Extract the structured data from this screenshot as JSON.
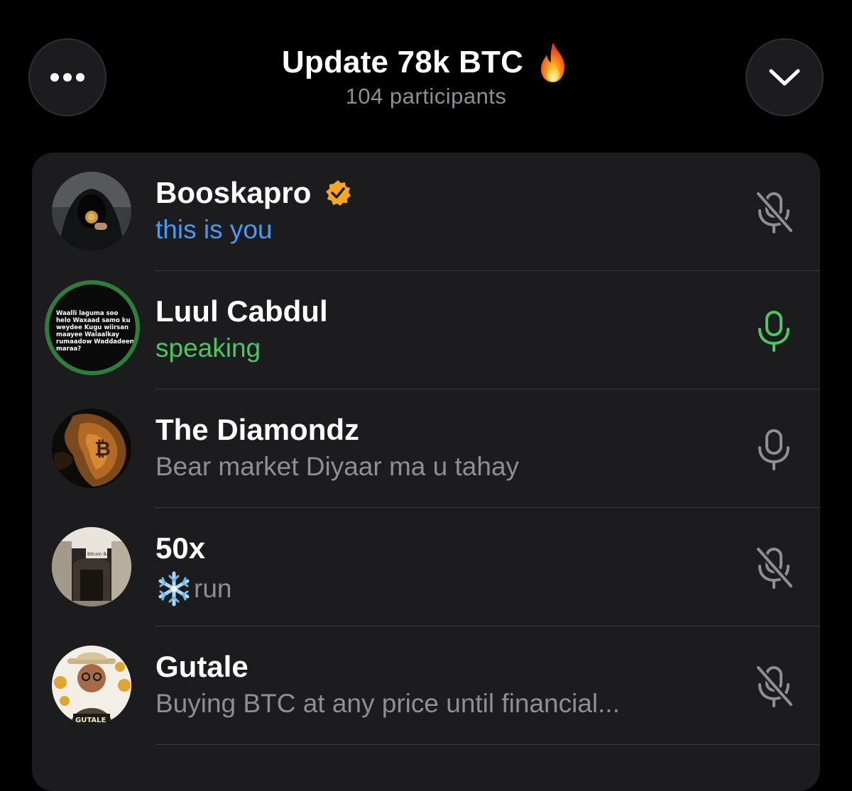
{
  "header": {
    "title": "Update 78k BTC",
    "title_icon": "fire-icon",
    "subtitle": "104 participants",
    "more_icon": "more-horizontal-icon",
    "collapse_icon": "chevron-down-icon"
  },
  "colors": {
    "background": "#000000",
    "panel": "#1c1c1e",
    "blue_status": "#4a9af5",
    "green_status": "#4cc662",
    "muted": "#8e8e93",
    "verified": "#f5a623"
  },
  "participants": [
    {
      "name": "Booskapro",
      "verified": true,
      "status": "this is you",
      "status_color": "blue",
      "mic": "muted",
      "avatar": "hooded-figure-with-bitcoin-avatar"
    },
    {
      "name": "Luul Cabdul",
      "verified": false,
      "status": "speaking",
      "status_color": "green",
      "mic": "active",
      "avatar": "text-poem-avatar",
      "avatar_text": "Waalli laguma soo helo Waxaad samo ku weydee Kugu wiirsan maayee Walaalkay rumaadow Waddadeen maraa?"
    },
    {
      "name": "The Diamondz",
      "verified": false,
      "status": "Bear market Diyaar ma u tahay",
      "status_color": "gray",
      "mic": "unmuted",
      "avatar": "lion-bitcoin-avatar"
    },
    {
      "name": "50x",
      "verified": false,
      "status": "run",
      "status_prefix_icon": "snowflake-icon",
      "status_color": "gray",
      "mic": "muted",
      "avatar": "bitcoin-bar-storefront-avatar",
      "avatar_sign": "Bitcoin Bar"
    },
    {
      "name": "Gutale",
      "verified": false,
      "status": "Buying BTC at any price until financial...",
      "status_color": "gray",
      "mic": "muted",
      "avatar": "man-with-hat-bitcoin-avatar",
      "avatar_label": "GUTALE"
    }
  ]
}
